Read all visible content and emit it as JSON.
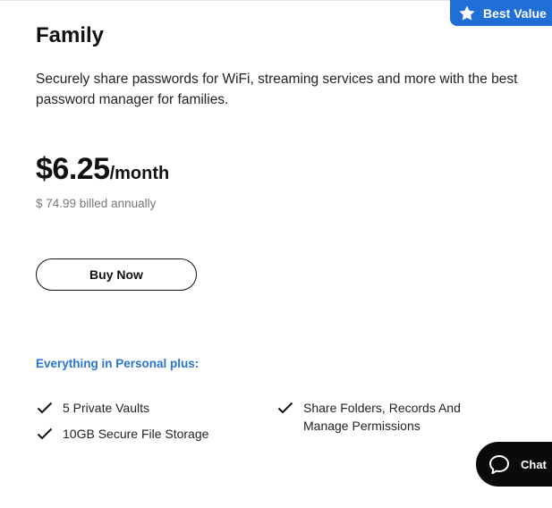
{
  "badge": {
    "label": "Best Value",
    "icon": "star-icon",
    "color": "#1f6fd6"
  },
  "plan": {
    "title": "Family",
    "description": "Securely share passwords for WiFi, streaming services and more with the best password manager for families.",
    "price_amount": "$6.25",
    "price_period": "/month",
    "billed": "$ 74.99 billed annually"
  },
  "cta": {
    "label": "Buy Now"
  },
  "features": {
    "heading": "Everything in Personal plus:",
    "heading_color": "#2a74d1",
    "items": [
      {
        "label": "5 Private Vaults",
        "icon": "check-icon"
      },
      {
        "label": "10GB Secure File Storage",
        "icon": "check-icon"
      },
      {
        "label": "Share Folders, Records And Manage Permissions",
        "icon": "check-icon"
      }
    ]
  },
  "chat": {
    "label": "Chat",
    "icon": "chat-bubble-icon"
  }
}
